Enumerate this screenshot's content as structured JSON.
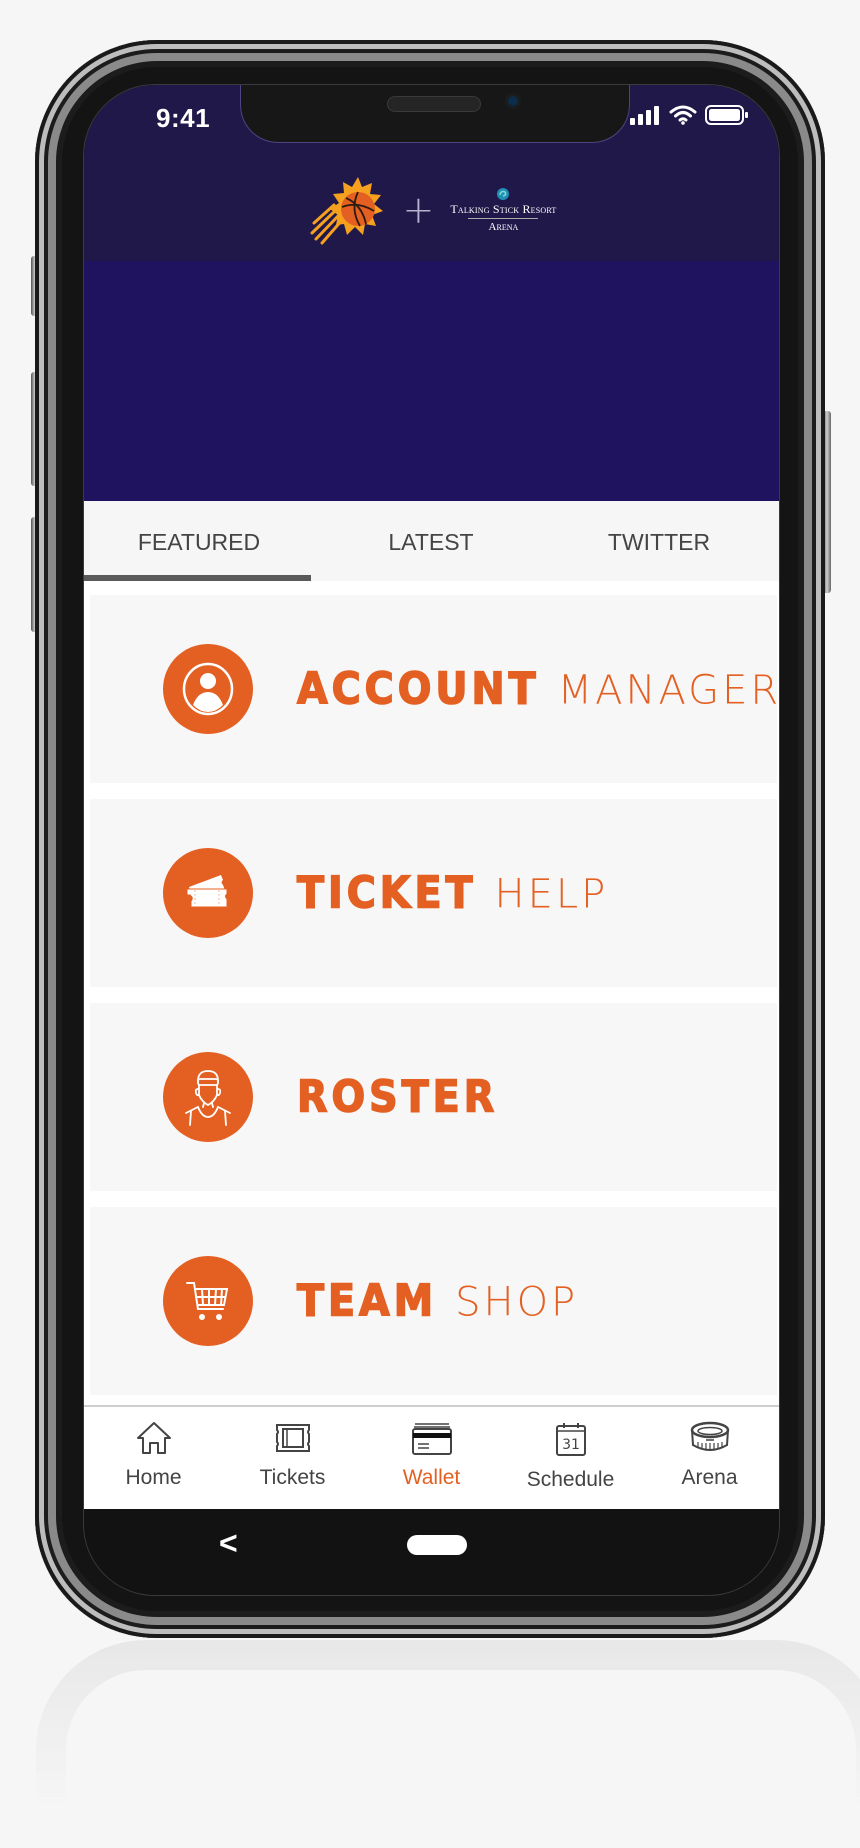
{
  "status_bar": {
    "time": "9:41",
    "icons": [
      "cellular-signal-icon",
      "wifi-icon",
      "battery-icon"
    ]
  },
  "header": {
    "team_logo": "phoenix-suns-logo",
    "plus_symbol": "+",
    "partner_logo_line1": "Talking Stick Resort",
    "partner_logo_line2": "Arena"
  },
  "tabs": [
    {
      "label": "FEATURED",
      "active": true
    },
    {
      "label": "LATEST",
      "active": false
    },
    {
      "label": "TWITTER",
      "active": false
    }
  ],
  "cards": [
    {
      "icon": "account-icon",
      "title_bold": "ACCOUNT",
      "title_light": "MANAGER"
    },
    {
      "icon": "ticket-icon",
      "title_bold": "TICKET",
      "title_light": "HELP"
    },
    {
      "icon": "player-icon",
      "title_bold": "ROSTER",
      "title_light": ""
    },
    {
      "icon": "cart-icon",
      "title_bold": "TEAM",
      "title_light": "SHOP"
    }
  ],
  "bottom_nav": [
    {
      "label": "Home",
      "icon": "home-icon",
      "active": false
    },
    {
      "label": "Tickets",
      "icon": "ticket-outline-icon",
      "active": false
    },
    {
      "label": "Wallet",
      "icon": "wallet-icon",
      "active": true
    },
    {
      "label": "Schedule",
      "icon": "calendar-icon",
      "active": false,
      "icon_text": "31"
    },
    {
      "label": "Arena",
      "icon": "arena-icon",
      "active": false
    }
  ],
  "system_nav": {
    "back": "<"
  },
  "colors": {
    "accent": "#e46022",
    "header_bg": "#21184a",
    "hero_bg": "#1f125e",
    "card_bg": "#f7f7f7",
    "tab_text": "#444444"
  }
}
